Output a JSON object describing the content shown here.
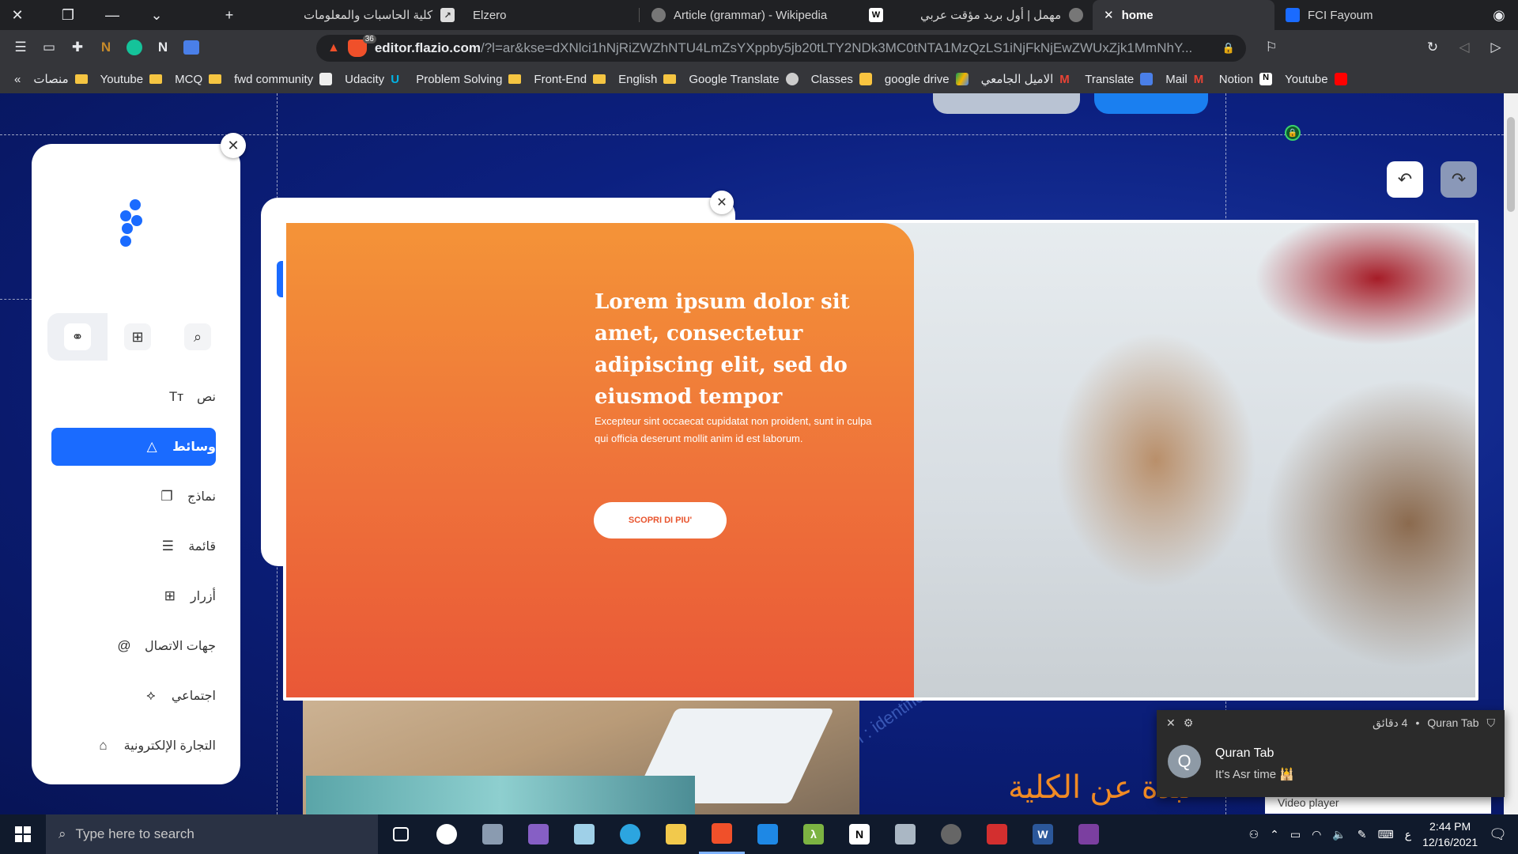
{
  "browser": {
    "tabs": [
      {
        "label": "كلية الحاسبات والمعلومات",
        "icon": "arrow-logo-icon",
        "active": false
      },
      {
        "label": "Elzero",
        "icon": "elzero-icon",
        "active": false
      },
      {
        "label": "Article (grammar) - Wikipedia",
        "icon": "wikipedia-icon",
        "active": false
      },
      {
        "label": "مهمل | أول بريد مؤقت عربي",
        "icon": "globe-icon",
        "active": false
      },
      {
        "label": "home",
        "icon": "flazio-icon",
        "active": true
      },
      {
        "label": "FCI Fayoum",
        "icon": "globe-icon",
        "active": false
      }
    ],
    "url_host": "editor.flazio.com",
    "url_path": "/?l=ar&kse=dXNlci1hNjRiZWZhNTU4LmZsYXppby5jb20tLTY2NDk3MC0tNTA1MzQzLS1iNjFkNjEwZWUxZjk1MmNhY...",
    "shield_count": "36",
    "bookmarks": [
      {
        "label": "منصات",
        "icon": "folder-icon"
      },
      {
        "label": "Youtube",
        "icon": "folder-icon"
      },
      {
        "label": "MCQ",
        "icon": "folder-icon"
      },
      {
        "label": "fwd community",
        "icon": "folder-icon"
      },
      {
        "label": "Udacity",
        "icon": "udacity-icon"
      },
      {
        "label": "Problem Solving",
        "icon": "folder-icon"
      },
      {
        "label": "Front-End",
        "icon": "folder-icon"
      },
      {
        "label": "English",
        "icon": "folder-icon"
      },
      {
        "label": "Google Translate",
        "icon": "globe-icon"
      },
      {
        "label": "Classes",
        "icon": "classroom-icon"
      },
      {
        "label": "google drive",
        "icon": "drive-icon"
      },
      {
        "label": "الاميل الجامعي",
        "icon": "gmail-icon"
      },
      {
        "label": "Translate",
        "icon": "translate-icon"
      },
      {
        "label": "Mail",
        "icon": "gmail-icon"
      },
      {
        "label": "Notion",
        "icon": "notion-icon"
      },
      {
        "label": "Youtube",
        "icon": "youtube-icon"
      }
    ]
  },
  "editor": {
    "panel_tabs": [
      "elements-icon",
      "grid-icon",
      "search-icon"
    ],
    "menu": [
      {
        "label": "نص",
        "icon": "Tт",
        "active": false
      },
      {
        "label": "وسائط",
        "icon": "△",
        "active": true
      },
      {
        "label": "نماذج",
        "icon": "❐",
        "active": false
      },
      {
        "label": "قائمة",
        "icon": "☰",
        "active": false
      },
      {
        "label": "أزرار",
        "icon": "⊞",
        "active": false
      },
      {
        "label": "جهات الاتصال",
        "icon": "@",
        "active": false
      },
      {
        "label": "اجتماعي",
        "icon": "⟡",
        "active": false
      },
      {
        "label": "التجارة الإلكترونية",
        "icon": "⌂",
        "active": false
      }
    ],
    "colors": {
      "accent": "#1a6bff",
      "orange": "#f08a24"
    }
  },
  "hero": {
    "title": "Lorem ipsum dolor sit amet, consectetur adipiscing elit, sed do eiusmod tempor",
    "body": "Excepteur sint occaecat cupidatat non proident, sunt in culpa qui officia deserunt mollit anim id est laborum.",
    "button": "SCOPRI DI PIU'"
  },
  "page_content": {
    "arabic_heading": "نبذة عن الكلية",
    "bg_text": "login : identification user"
  },
  "notification": {
    "app": "Quran Tab",
    "time": "4 دقائق",
    "title": "Quran Tab",
    "message": "It's Asr time 🕌",
    "avatar_letter": "Q",
    "below": "Video player"
  },
  "taskbar": {
    "search_placeholder": "Type here to search",
    "time": "2:44 PM",
    "date": "12/16/2021",
    "lang": "ع"
  }
}
